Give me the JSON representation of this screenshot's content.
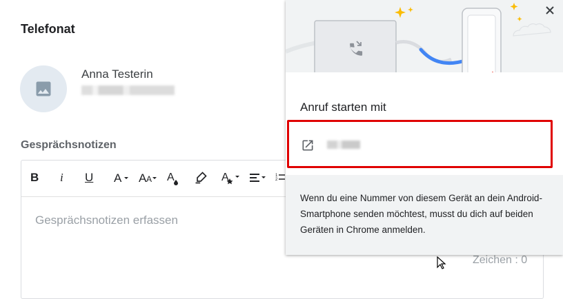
{
  "call_panel": {
    "title": "Telefonat",
    "contact_name": "Anna Testerin",
    "notes_label": "Gesprächsnotizen",
    "notes_placeholder": "Gesprächsnotizen erfassen",
    "char_count": "Zeichen : 0",
    "toolbar": {
      "bold": "B",
      "italic": "i",
      "underline": "U"
    }
  },
  "popup": {
    "heading": "Anruf starten mit",
    "close": "×",
    "info_text": "Wenn du eine Nummer von diesem Gerät an dein Android-Smartphone senden möchtest, musst du dich auf beiden Geräten in Chrome anmelden."
  },
  "colors": {
    "highlight": "#e00000",
    "accent_blue": "#4285f4",
    "star_yellow": "#fbbc04"
  }
}
